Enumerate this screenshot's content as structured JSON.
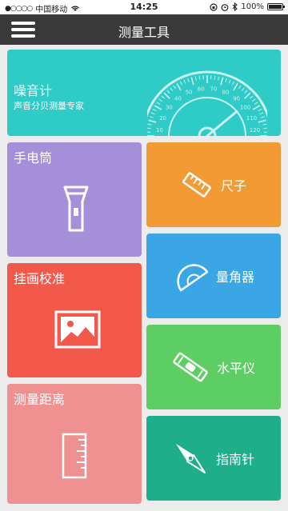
{
  "status": {
    "signal_dots": "●○○○○",
    "carrier": "中国移动",
    "time": "14:25",
    "battery": "100%",
    "battery_level": 1.0
  },
  "header": {
    "title": "测量工具"
  },
  "tiles": {
    "noise": {
      "title": "噪音计",
      "subtitle": "声音分贝测量专家",
      "gauge_ticks": [
        "10",
        "20",
        "30",
        "40",
        "50",
        "60",
        "70",
        "80",
        "90",
        "100",
        "110",
        "120"
      ]
    },
    "flashlight": {
      "title": "手电筒"
    },
    "ruler": {
      "title": "尺子"
    },
    "protractor": {
      "title": "量角器"
    },
    "hang": {
      "title": "挂画校准"
    },
    "level": {
      "title": "水平仪"
    },
    "distance": {
      "title": "测量距离"
    },
    "compass": {
      "title": "指南针"
    }
  },
  "colors": {
    "noise": "#2fcbc7",
    "flashlight": "#a58fd8",
    "ruler": "#f29a33",
    "protractor": "#3aa6e6",
    "hang": "#f2594b",
    "level": "#5cce63",
    "distance": "#ef9190",
    "compass": "#1fae8a",
    "navbar": "#3a3a3a"
  }
}
